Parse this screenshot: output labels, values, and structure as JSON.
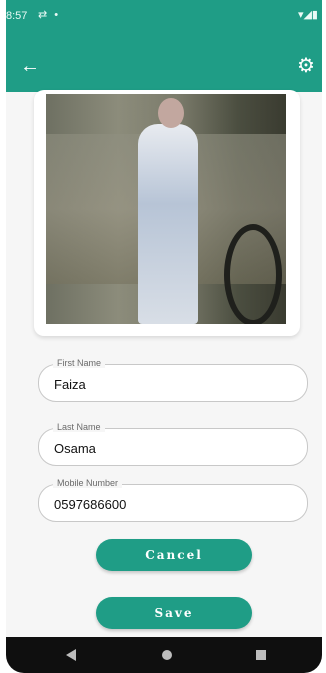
{
  "status_bar": {
    "time": "8:57",
    "notification_icons": "⇄ •",
    "system_icons": "▾◢▮"
  },
  "app_bar": {
    "back_icon": "arrow-left-icon",
    "settings_icon": "gear-icon"
  },
  "photo": {
    "description_icon": "profile-photo"
  },
  "form": {
    "first_name": {
      "label": "First Name",
      "value": "Faiza"
    },
    "last_name": {
      "label": "Last Name",
      "value": "Osama"
    },
    "mobile": {
      "label": "Mobile Number",
      "value": "0597686600"
    }
  },
  "buttons": {
    "cancel": "Cancel",
    "save": "Save"
  },
  "colors": {
    "primary": "#1f9d86",
    "background": "#f6f6f6"
  }
}
